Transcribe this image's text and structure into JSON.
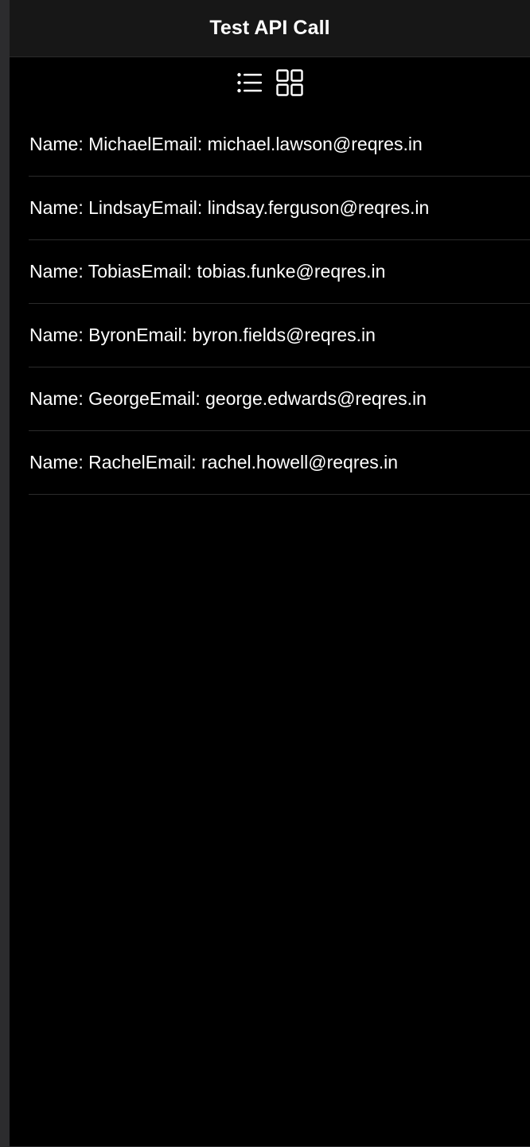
{
  "nav": {
    "title": "Test API Call"
  },
  "view_toggle": {
    "list_icon": "list-icon",
    "grid_icon": "grid-icon"
  },
  "colors": {
    "background": "#000000",
    "nav_background": "#171717",
    "text": "#ffffff",
    "separator": "#2b2b2b"
  },
  "users": [
    {
      "label": "Name: MichaelEmail: michael.lawson@reqres.in"
    },
    {
      "label": "Name: LindsayEmail: lindsay.ferguson@reqres.in"
    },
    {
      "label": "Name: TobiasEmail: tobias.funke@reqres.in"
    },
    {
      "label": "Name: ByronEmail: byron.fields@reqres.in"
    },
    {
      "label": "Name: GeorgeEmail: george.edwards@reqres.in"
    },
    {
      "label": "Name: RachelEmail: rachel.howell@reqres.in"
    }
  ]
}
